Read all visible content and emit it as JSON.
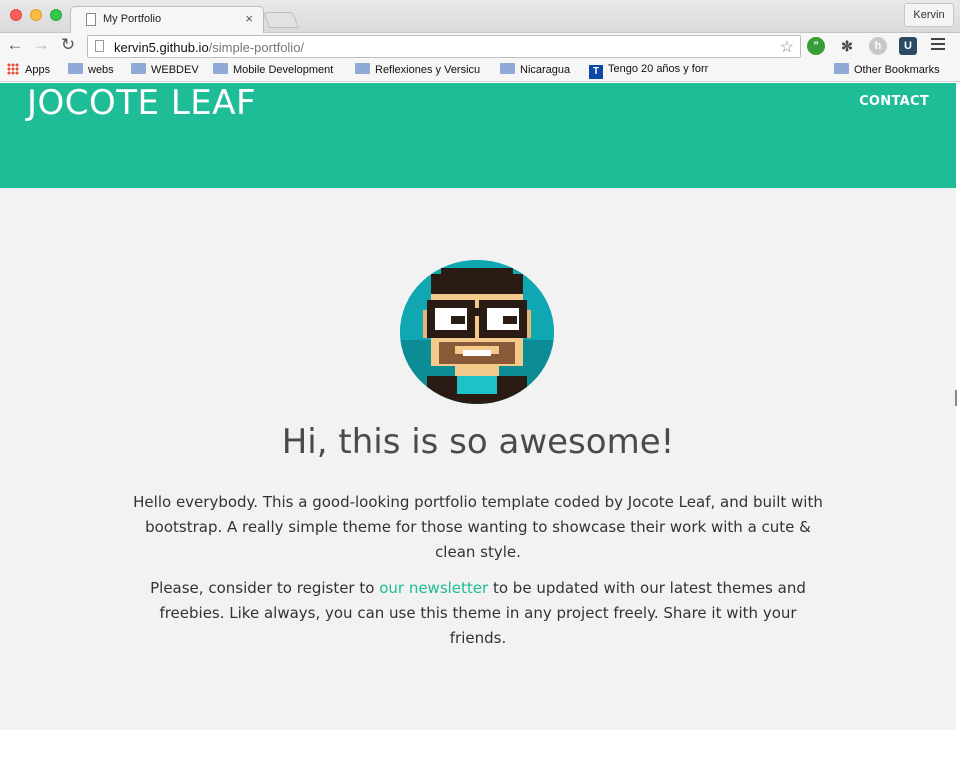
{
  "window": {
    "profile_name": "Kervin"
  },
  "tab": {
    "title": "My Portfolio",
    "close_glyph": "×"
  },
  "omnibox": {
    "host": "kervin5.github.io",
    "path": "/simple-portfolio/"
  },
  "bookmarks": [
    {
      "label": "Apps",
      "icon": "apps-grid-icon"
    },
    {
      "label": "webs",
      "icon": "folder-icon"
    },
    {
      "label": "WEBDEV",
      "icon": "folder-icon"
    },
    {
      "label": "Mobile Development",
      "icon": "folder-icon"
    },
    {
      "label": "Reflexiones y Versicu",
      "icon": "folder-icon"
    },
    {
      "label": "Nicaragua",
      "icon": "folder-icon"
    },
    {
      "label": "Tengo 20 años y forr",
      "icon": "t-icon"
    },
    {
      "label": "Other Bookmarks",
      "icon": "folder-icon"
    }
  ],
  "site": {
    "brand": "JOCOTE LEAF",
    "nav_contact": "CONTACT",
    "heading": "Hi, this is so awesome!",
    "para1": "Hello everybody. This a good-looking portfolio template coded by Jocote Leaf, and built with bootstrap. A really simple theme for those wanting to showcase their work with a cute & clean style.",
    "para2_before": "Please, consider to register to ",
    "para2_link": "our newsletter",
    "para2_after": " to be updated with our latest themes and freebies. Like always, you can use this theme in any project freely. Share it with your friends."
  },
  "colors": {
    "accent": "#1ebc97",
    "section_bg": "#f2f2f2",
    "text": "#333333",
    "avatar_bg": "#0fa7b1"
  }
}
